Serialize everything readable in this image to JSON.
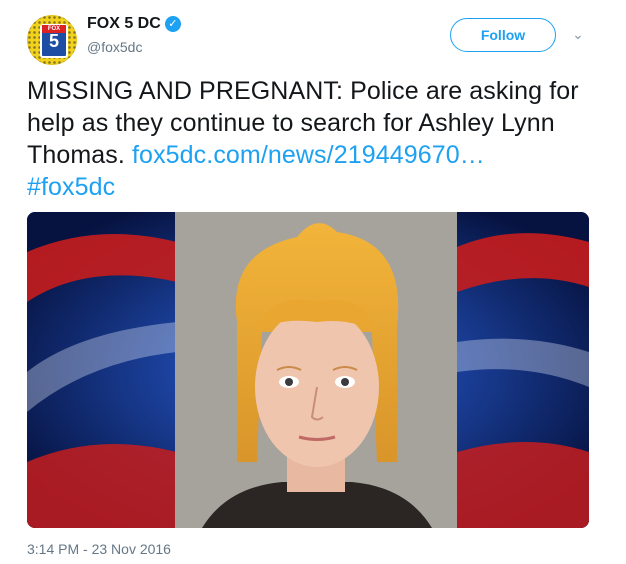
{
  "account": {
    "name": "FOX 5 DC",
    "handle": "@fox5dc",
    "verified_icon": "verified-badge-icon",
    "avatar_badge_text": "5",
    "avatar_badge_top": "FOX"
  },
  "actions": {
    "follow_label": "Follow",
    "more_icon": "chevron-down-icon"
  },
  "tweet": {
    "text": "MISSING AND PREGNANT: Police are asking for help as they continue to search for Ashley Lynn Thomas.",
    "link": "fox5dc.com/news/219449670…",
    "hashtag": "#fox5dc",
    "timestamp": "3:14 PM - 23 Nov 2016"
  },
  "colors": {
    "accent": "#1da1f2",
    "text": "#14171a",
    "muted": "#657786"
  }
}
